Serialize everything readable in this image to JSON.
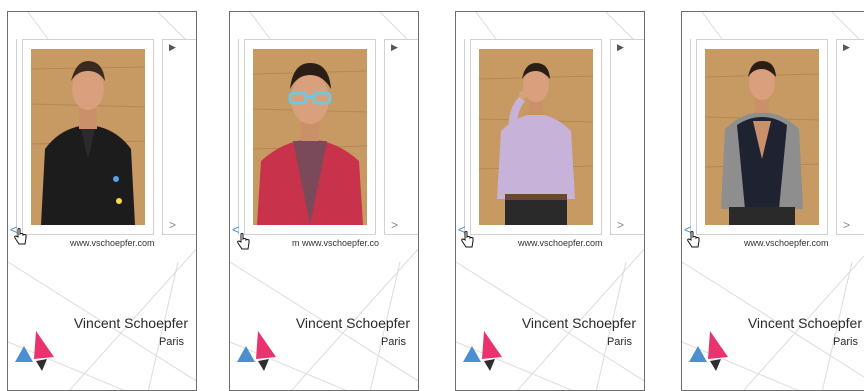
{
  "screens": [
    {
      "url": "www.vschoepfer.com",
      "name": "Vincent Schoepfer",
      "city": "Paris",
      "photo_alt": "portrait-black-shirt"
    },
    {
      "url": "m www.vschoepfer.co",
      "name": "Vincent Schoepfer",
      "city": "Paris",
      "photo_alt": "portrait-blue-glasses-red-sweater"
    },
    {
      "url": "www.vschoepfer.com",
      "name": "Vincent Schoepfer",
      "city": "Paris",
      "photo_alt": "portrait-lilac-shirt"
    },
    {
      "url": "www.vschoepfer.com",
      "name": "Vincent Schoepfer",
      "city": "Paris",
      "photo_alt": "portrait-grey-cardigan-vest"
    }
  ],
  "controls": {
    "next_top": "▶",
    "next_bottom": ">",
    "back": "<"
  },
  "colors": {
    "logo_pink": "#e8336f",
    "logo_blue": "#4a8fd0",
    "logo_dark": "#2e2e2e",
    "wood": "#c79a63"
  },
  "icons": [
    "play-icon",
    "chevron-right-icon",
    "chevron-left-icon",
    "hand-cursor-icon",
    "triangle-logo-icon"
  ]
}
